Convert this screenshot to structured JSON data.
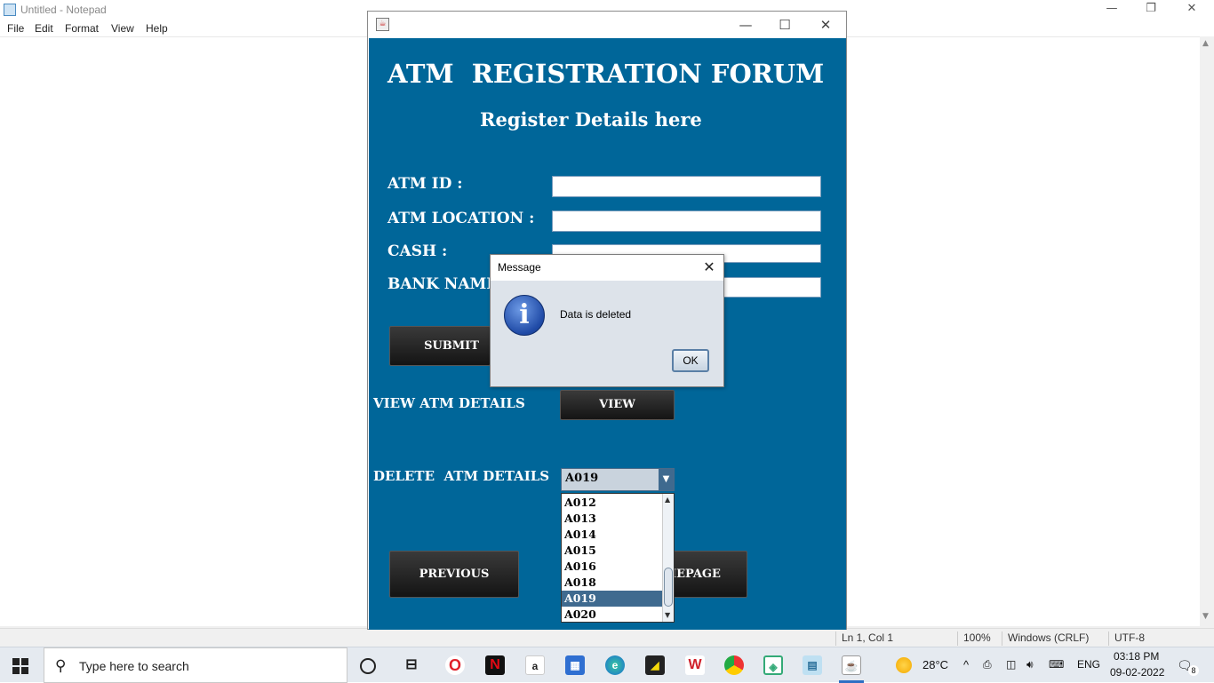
{
  "notepad": {
    "title": "Untitled - Notepad",
    "menu": [
      "File",
      "Edit",
      "Format",
      "View",
      "Help"
    ],
    "status": {
      "position": "Ln 1, Col 1",
      "zoom": "100%",
      "line_ending": "Windows (CRLF)",
      "encoding": "UTF-8"
    }
  },
  "form": {
    "title": "ATM  REGISTRATION FORUM",
    "subtitle": "Register Details here",
    "labels": {
      "atm_id": "ATM ID :",
      "atm_location": "ATM LOCATION :",
      "cash": "CASH :",
      "bank_name": "BANK NAME :"
    },
    "fields": {
      "atm_id": "",
      "atm_location": "",
      "cash": "",
      "bank_name": ""
    },
    "submit_label": "SUBMIT",
    "view_label": "VIEW ATM DETAILS",
    "view_button": "VIEW",
    "delete_label": "DELETE  ATM DETAILS",
    "previous_button": "PREVIOUS",
    "homepage_button": "HOMEPAGE",
    "combo_selected": "A019",
    "combo_options": [
      "A012",
      "A013",
      "A014",
      "A015",
      "A016",
      "A018",
      "A019",
      "A020"
    ]
  },
  "dialog": {
    "title": "Message",
    "message": "Data is deleted",
    "ok_label": "OK"
  },
  "taskbar": {
    "search_placeholder": "Type here to search",
    "weather": "28°C",
    "language": "ENG",
    "time": "03:18 PM",
    "date": "09-02-2022",
    "notifications": "8"
  }
}
